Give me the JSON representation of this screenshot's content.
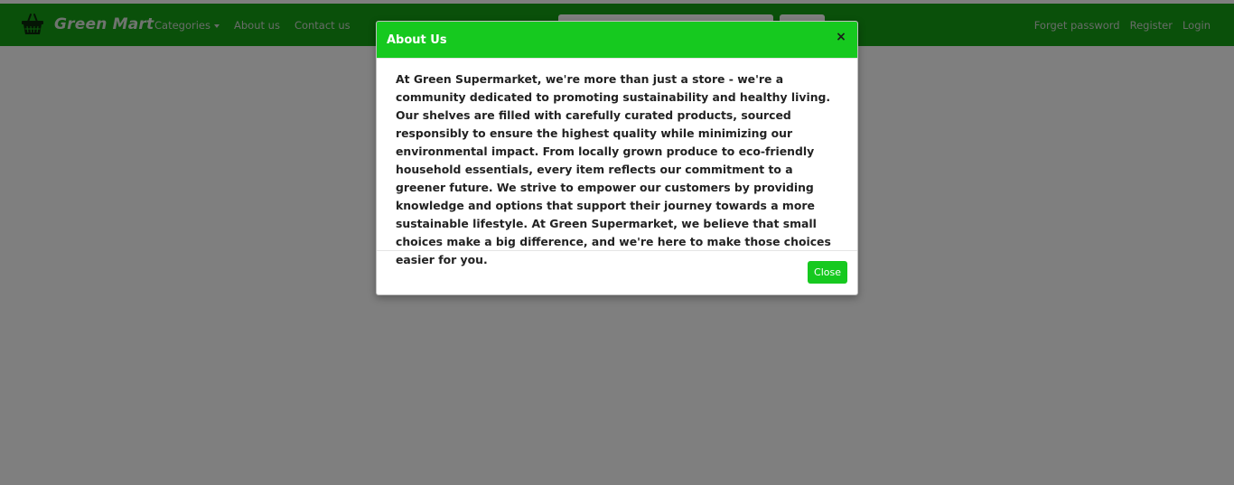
{
  "colors": {
    "navbar": "#14a014",
    "modal_header": "#16c91f",
    "close_button": "#16c91f",
    "backdrop": "rgba(0,0,0,0.5)"
  },
  "navbar": {
    "brand": "Green Mart",
    "brand_icon": "basket-icon",
    "links": {
      "categories": "Categories",
      "about": "About us",
      "contact": "Contact us"
    },
    "right_links": {
      "forget_password": "Forget password",
      "register": "Register",
      "login": "Login"
    }
  },
  "modal": {
    "title": "About Us",
    "close_symbol": "×",
    "body": "At Green Supermarket, we're more than just a store - we're a community dedicated to promoting sustainability and healthy living. Our shelves are filled with carefully curated products, sourced responsibly to ensure the highest quality while minimizing our environmental impact. From locally grown produce to eco-friendly household essentials, every item reflects our commitment to a greener future. We strive to empower our customers by providing knowledge and options that support their journey towards a more sustainable lifestyle. At Green Supermarket, we believe that small choices make a big difference, and we're here to make those choices easier for you.",
    "close_button": "Close"
  }
}
